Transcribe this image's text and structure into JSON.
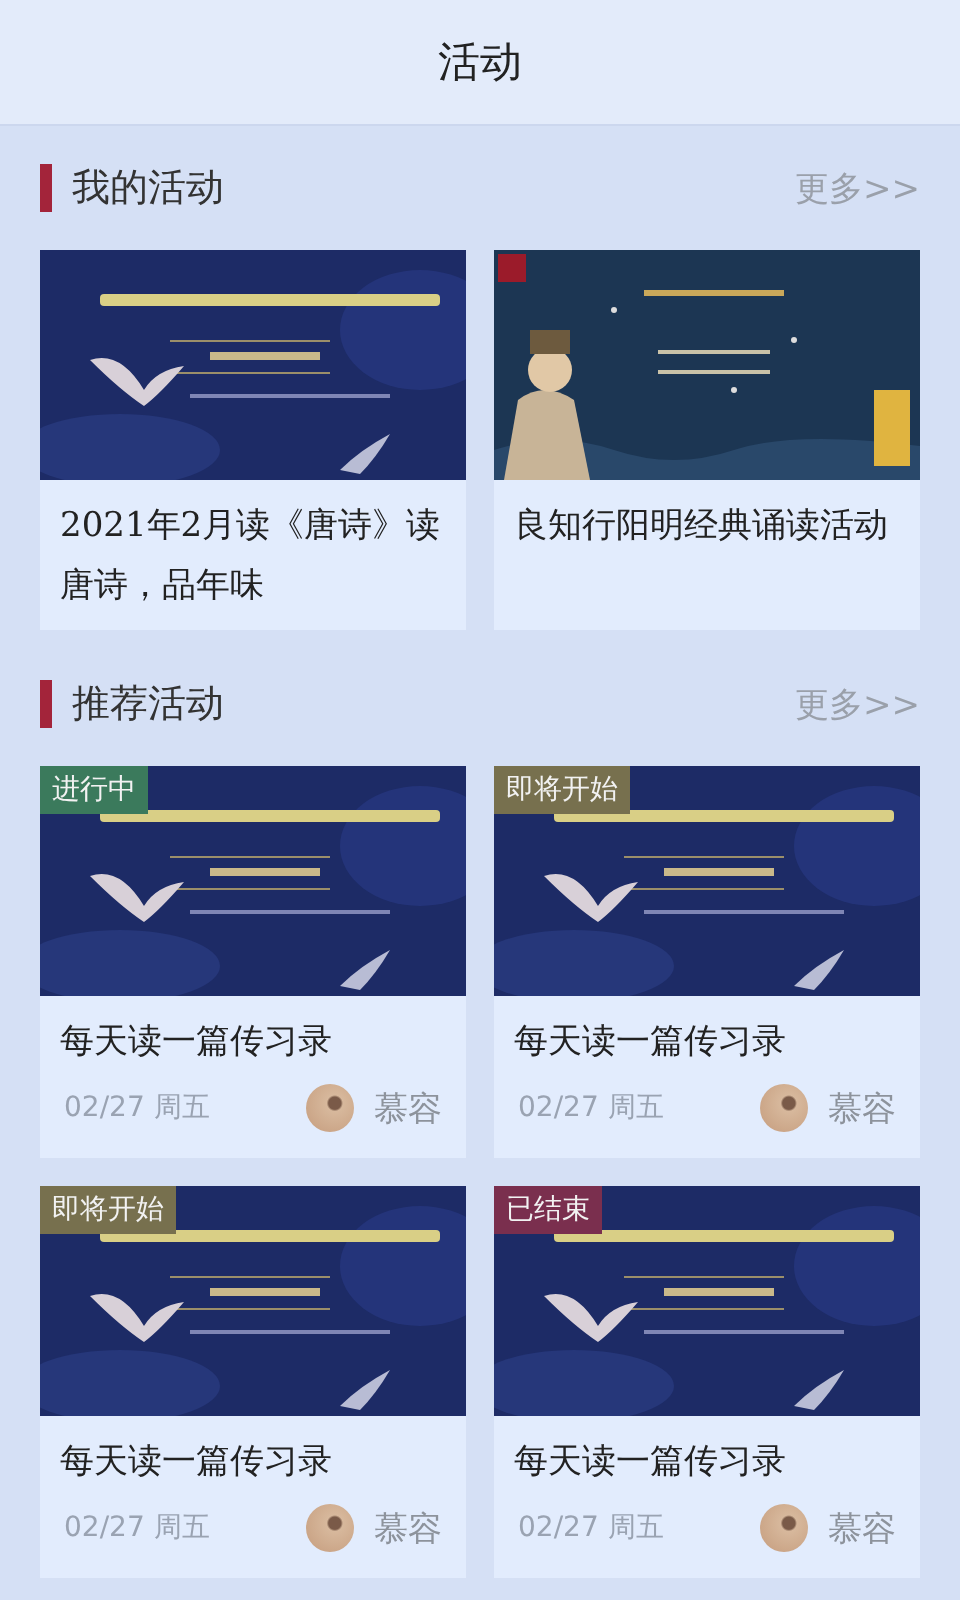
{
  "header": {
    "title": "活动"
  },
  "sections": [
    {
      "title": "我的活动",
      "more": "更多>>",
      "kind": "mine",
      "cards": [
        {
          "title": "2021年2月读《唐诗》读唐诗，品年味",
          "kind": "crane"
        },
        {
          "title": "良知行阳明经典诵读活动",
          "kind": "scholar"
        }
      ]
    },
    {
      "title": "推荐活动",
      "more": "更多>>",
      "kind": "recommend",
      "cards": [
        {
          "title": "每天读一篇传习录",
          "kind": "crane",
          "status": "进行中",
          "color": "#3b7a5c",
          "date": "02/27 周五",
          "author": "慕容"
        },
        {
          "title": "每天读一篇传习录",
          "kind": "crane",
          "status": "即将开始",
          "color": "#77704e",
          "date": "02/27 周五",
          "author": "慕容"
        },
        {
          "title": "每天读一篇传习录",
          "kind": "crane",
          "status": "即将开始",
          "color": "#77704e",
          "date": "02/27 周五",
          "author": "慕容"
        },
        {
          "title": "每天读一篇传习录",
          "kind": "crane",
          "status": "已结束",
          "color": "#7a2f4e",
          "date": "02/27 周五",
          "author": "慕容"
        }
      ]
    }
  ]
}
